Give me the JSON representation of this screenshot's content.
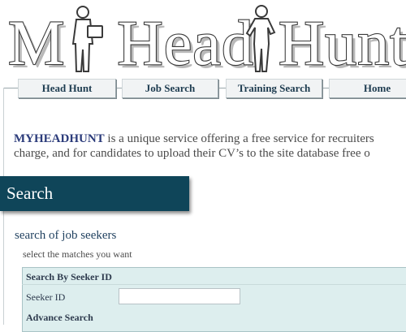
{
  "logo": {
    "text": "MY Head Hunt",
    "icons": [
      "man-silhouette-icon",
      "woman-silhouette-icon"
    ]
  },
  "nav": {
    "tabs": [
      {
        "label": "Head Hunt"
      },
      {
        "label": "Job Search"
      },
      {
        "label": "Training Search"
      },
      {
        "label": "Home"
      }
    ]
  },
  "intro": {
    "brand": "MYHEADHUNT",
    "line1_rest": " is a unique service offering a free service for recruiters",
    "line2": "charge, and for candidates to upload their CV’s to the site database free o"
  },
  "banner": {
    "title": "Search"
  },
  "search": {
    "section_title": "search of job seekers",
    "section_subtitle": "select the matches you want",
    "by_id_heading": "Search By Seeker ID",
    "seeker_id_label": "Seeker ID",
    "seeker_id_value": "",
    "advance_heading": "Advance Search"
  },
  "colors": {
    "banner_bg": "#0f4559",
    "panel_bg": "#ddeeee",
    "brand_text": "#2b3b7a",
    "tab_text": "#1e3c50"
  }
}
